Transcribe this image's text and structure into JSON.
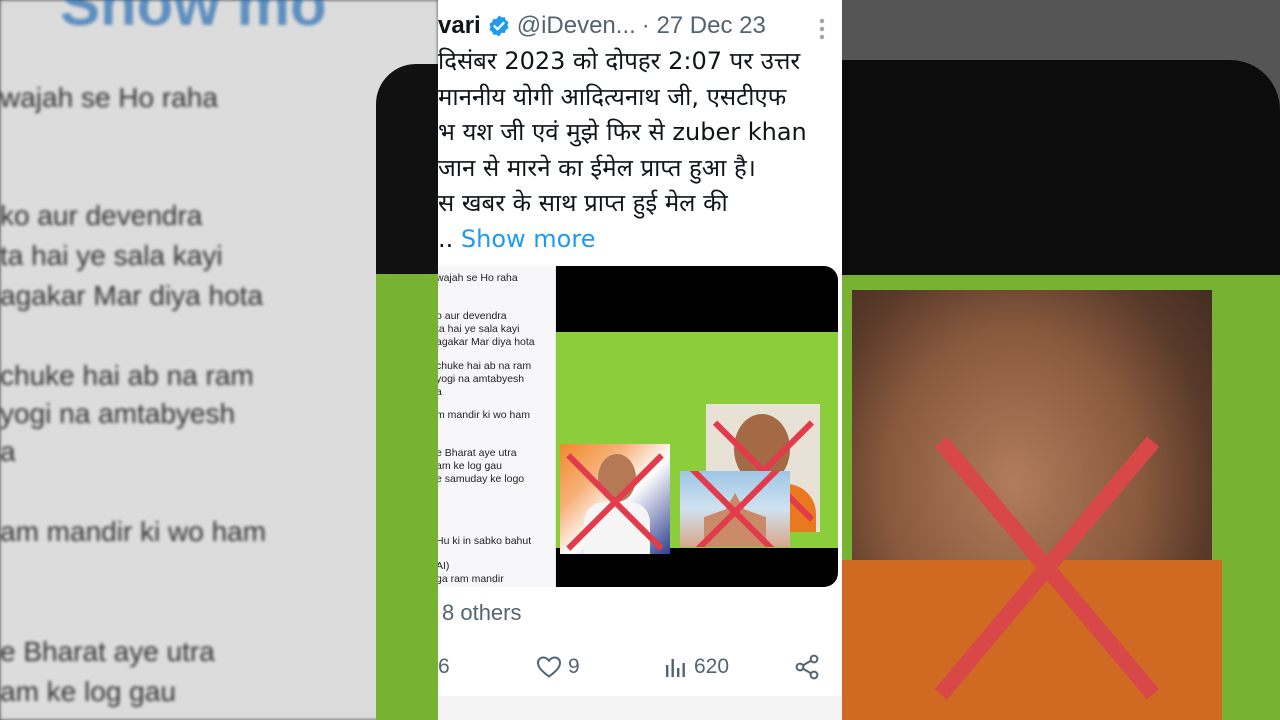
{
  "background": {
    "left_top_text": "Show mo",
    "left_lines": [
      "wajah se Ho raha",
      "ko aur devendra",
      "ta hai ye sala kayi",
      "agakar Mar diya hota",
      "chuke hai ab na ram",
      "yogi na amtabyesh",
      "a",
      "am mandir ki wo ham",
      "e Bharat aye utra",
      "am ke log gau"
    ]
  },
  "tweet": {
    "author_name": "vari",
    "handle": "@iDeven...",
    "date": "· 27 Dec 23",
    "text_lines": [
      "दिसंबर 2023 को दोपहर 2:07 पर उत्तर",
      "माननीय योगी आदित्यनाथ जी, एसटीएफ",
      "भ यश जी एवं मुझे फिर से zuber khan",
      "जान से मारने का ईमेल प्राप्त हुआ है।",
      "स खबर के साथ प्राप्त हुई मेल की"
    ],
    "ellipsis": "..",
    "show_more": "Show more",
    "media_text_lines": [
      "wajah se Ho raha",
      "o aur devendra",
      "ta hai ye sala kayi",
      "agakar Mar diya hota",
      "chuke hai ab na ram",
      "yogi na amtabyesh",
      "a",
      "m mandir ki wo ham",
      "e Bharat aye utra",
      "am ke log gau",
      "e samuday ke logo",
      "Hu ki in sabko bahut",
      "AI)",
      "ga ram mandir"
    ],
    "liked_by": "8 others",
    "reply_count": "6",
    "like_count": "9",
    "view_count": "620"
  },
  "colors": {
    "link": "#1d9bf0",
    "muted": "#536471",
    "verified": "#1d9bf0",
    "cross": "#e23b4b",
    "green_bg": "#8ccd3c"
  },
  "icons": [
    "verified-badge-icon",
    "more-options-icon",
    "heart-icon",
    "views-chart-icon",
    "share-icon"
  ]
}
